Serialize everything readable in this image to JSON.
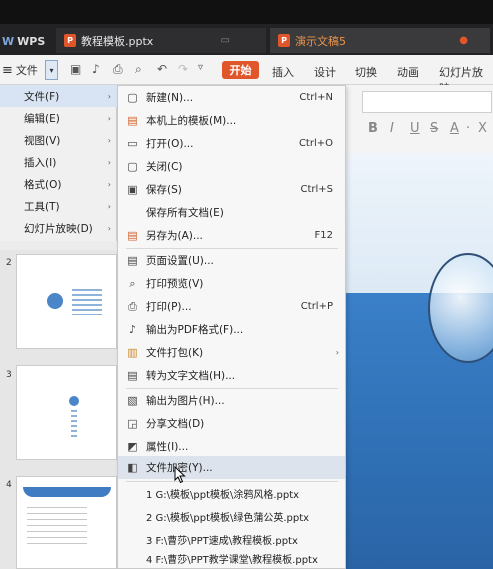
{
  "tabs": {
    "app_label": "WPS",
    "doc1": "教程模板.pptx",
    "doc2": "演示文稿5"
  },
  "ribbon": {
    "file_label": "文件",
    "start_label": "开始",
    "tabs": [
      "插入",
      "设计",
      "切换",
      "动画",
      "幻灯片放映"
    ]
  },
  "file_submenu": [
    {
      "label": "文件(F)"
    },
    {
      "label": "编辑(E)"
    },
    {
      "label": "视图(V)"
    },
    {
      "label": "插入(I)"
    },
    {
      "label": "格式(O)"
    },
    {
      "label": "工具(T)"
    },
    {
      "label": "幻灯片放映(D)"
    }
  ],
  "dropdown": {
    "items": [
      {
        "label": "新建(N)...",
        "shortcut": "Ctrl+N",
        "icon": "new-doc-icon"
      },
      {
        "label": "本机上的模板(M)...",
        "shortcut": "",
        "icon": "template-icon"
      },
      {
        "label": "打开(O)...",
        "shortcut": "Ctrl+O",
        "icon": "folder-icon"
      },
      {
        "label": "关闭(C)",
        "shortcut": "",
        "icon": "close-doc-icon"
      },
      {
        "label": "保存(S)",
        "shortcut": "Ctrl+S",
        "icon": "save-icon"
      },
      {
        "label": "保存所有文档(E)",
        "shortcut": "",
        "icon": ""
      },
      {
        "label": "另存为(A)...",
        "shortcut": "F12",
        "icon": "save-as-icon"
      },
      {
        "label": "页面设置(U)...",
        "shortcut": "",
        "icon": "page-setup-icon"
      },
      {
        "label": "打印预览(V)",
        "shortcut": "",
        "icon": "print-preview-icon"
      },
      {
        "label": "打印(P)...",
        "shortcut": "Ctrl+P",
        "icon": "print-icon"
      },
      {
        "label": "输出为PDF格式(F)...",
        "shortcut": "",
        "icon": "pdf-icon"
      },
      {
        "label": "文件打包(K)",
        "shortcut": "",
        "icon": "package-icon"
      },
      {
        "label": "转为文字文档(H)...",
        "shortcut": "",
        "icon": "convert-icon"
      },
      {
        "label": "输出为图片(H)...",
        "shortcut": "",
        "icon": "image-export-icon"
      },
      {
        "label": "分享文档(D)",
        "shortcut": "",
        "icon": "share-icon"
      },
      {
        "label": "属性(I)...",
        "shortcut": "",
        "icon": "properties-icon"
      },
      {
        "label": "文件加密(Y)...",
        "shortcut": "",
        "icon": "encrypt-icon"
      }
    ],
    "recent": [
      "1 G:\\模板\\ppt模板\\涂鸦风格.pptx",
      "2 G:\\模板\\ppt模板\\绿色蒲公英.pptx",
      "3 F:\\曹莎\\PPT速成\\教程模板.pptx",
      "4 F:\\曹莎\\PPT教学课堂\\教程模板.pptx"
    ]
  },
  "slides": {
    "numbers": [
      "2",
      "3",
      "4"
    ]
  },
  "colors": {
    "accent": "#e0562a",
    "hover": "#dde3ec"
  }
}
